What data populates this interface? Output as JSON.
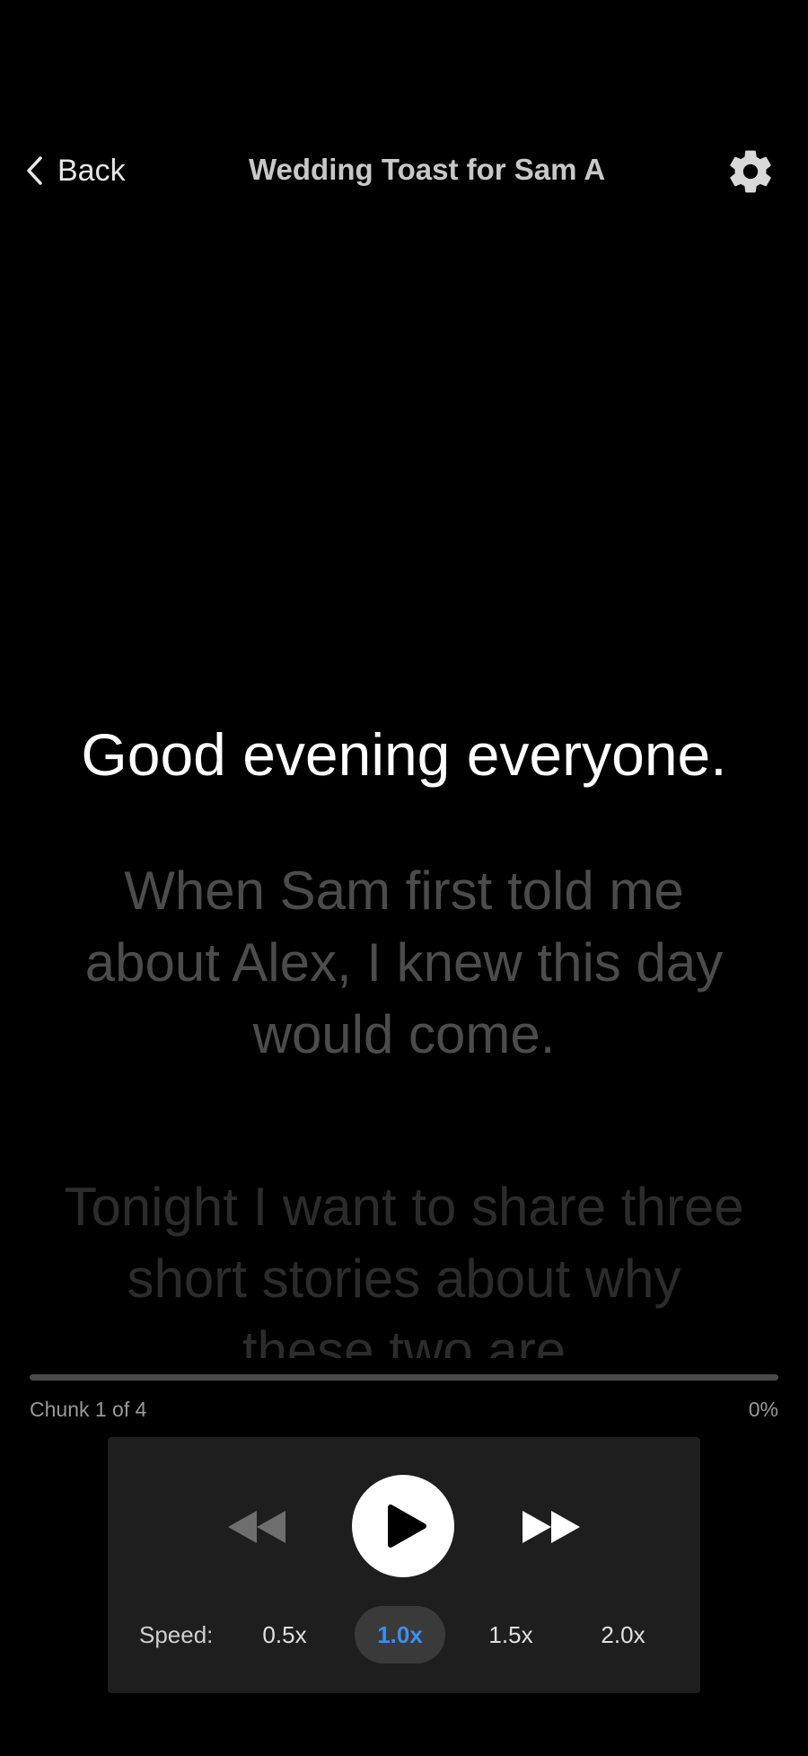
{
  "header": {
    "back_label": "Back",
    "title": "Wedding Toast for Sam A",
    "settings_icon": "gear-icon",
    "back_icon": "chevron-left-icon"
  },
  "script": {
    "current_line": "Good evening everyone.",
    "next_line": "When Sam first told me about Alex, I knew this day would come.",
    "later_line": "Tonight I want to share three short stories about why these two are"
  },
  "progress": {
    "chunk_label": "Chunk 1 of 4",
    "percent_label": "0%",
    "percent_value": 0
  },
  "controls": {
    "rewind_icon": "rewind-icon",
    "play_icon": "play-icon",
    "forward_icon": "fast-forward-icon",
    "speed_label": "Speed:",
    "speed_options": [
      "0.5x",
      "1.0x",
      "1.5x",
      "2.0x"
    ],
    "selected_speed": "1.0x"
  },
  "colors": {
    "background": "#000000",
    "panel": "#1e1e1e",
    "accent": "#3b8ff0",
    "selected_speed_bg": "#3a3a3a"
  }
}
